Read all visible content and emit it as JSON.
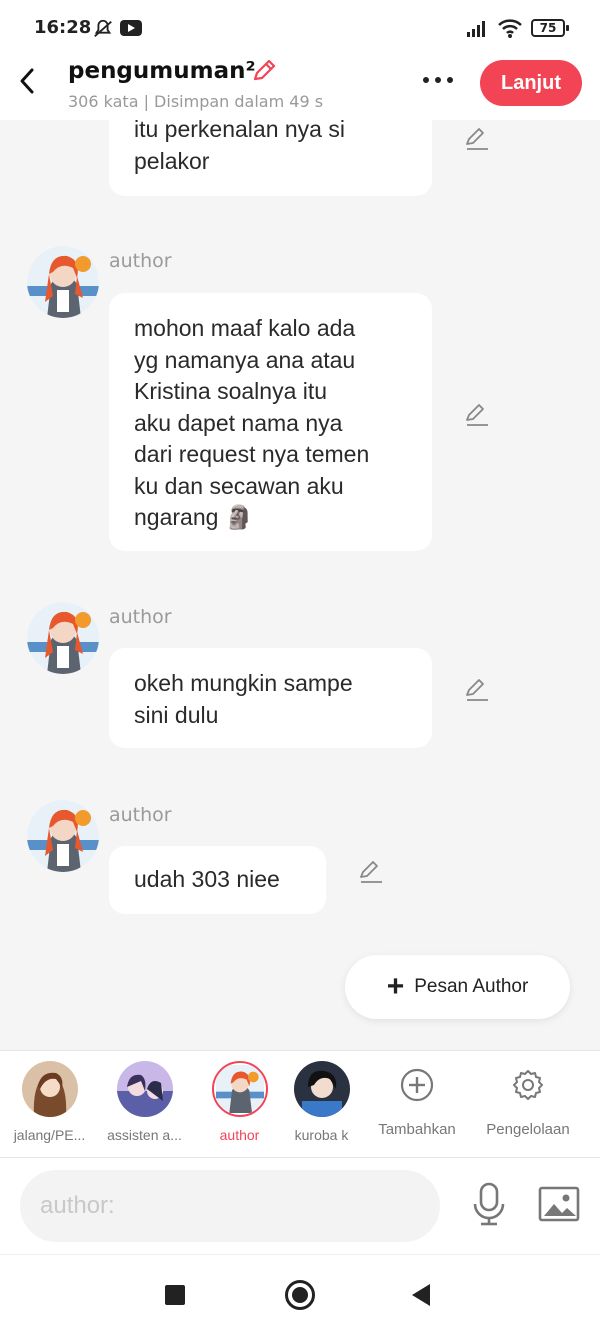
{
  "status_bar": {
    "time": "16:28",
    "battery": "75"
  },
  "header": {
    "title": "pengumuman²",
    "subtitle": "306 kata | Disimpan dalam 49 s",
    "next_label": "Lanjut"
  },
  "messages": [
    {
      "author": "",
      "text": "itu perkenalan nya si\npelakor"
    },
    {
      "author": "author",
      "text": "mohon maaf kalo ada\nyg namanya ana atau\nKristina soalnya itu\naku dapet nama nya\ndari request nya temen\nku dan secawan aku\nngarang 🗿"
    },
    {
      "author": "author",
      "text": "okeh mungkin sampe\nsini dulu"
    },
    {
      "author": "author",
      "text": "udah 303 niee"
    }
  ],
  "pesan_author": {
    "label": "Pesan Author"
  },
  "characters": [
    {
      "label": "jalang/PE..."
    },
    {
      "label": "assisten a..."
    },
    {
      "label": "author"
    },
    {
      "label": "kuroba k"
    }
  ],
  "tools": {
    "add_label": "Tambahkan",
    "manage_label": "Pengelolaan"
  },
  "composer": {
    "placeholder": "author:"
  },
  "colors": {
    "accent": "#f24455",
    "background": "#f5f5f5"
  }
}
